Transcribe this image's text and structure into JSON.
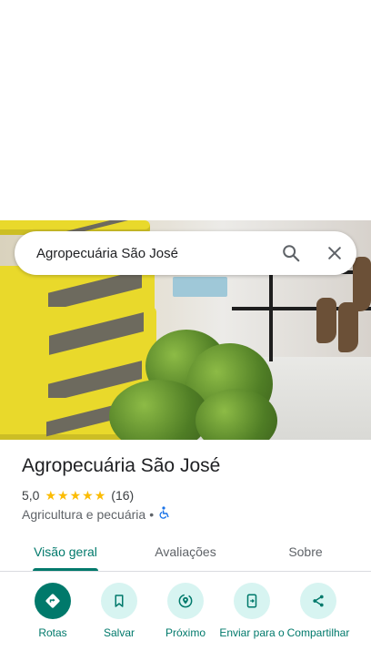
{
  "search": {
    "query": "Agropecuária São José",
    "search_icon": "search-icon",
    "close_icon": "close-icon"
  },
  "place": {
    "name": "Agropecuária São José",
    "rating": "5,0",
    "stars": 5,
    "review_count": "(16)",
    "category": "Agricultura e pecuária",
    "separator": "•",
    "accessibility_icon": "wheelchair-icon"
  },
  "tabs": [
    {
      "label": "Visão geral",
      "active": true
    },
    {
      "label": "Avaliações",
      "active": false
    },
    {
      "label": "Sobre",
      "active": false
    }
  ],
  "actions": [
    {
      "label": "Rotas",
      "icon": "directions-icon"
    },
    {
      "label": "Salvar",
      "icon": "bookmark-icon"
    },
    {
      "label": "Próximo",
      "icon": "nearby-icon"
    },
    {
      "label": "Enviar para o",
      "icon": "send-to-phone-icon"
    },
    {
      "label": "Compartilhar",
      "icon": "share-icon"
    }
  ],
  "colors": {
    "accent": "#00796b",
    "accent_light": "#d7f4f1",
    "star": "#fbbc04"
  }
}
